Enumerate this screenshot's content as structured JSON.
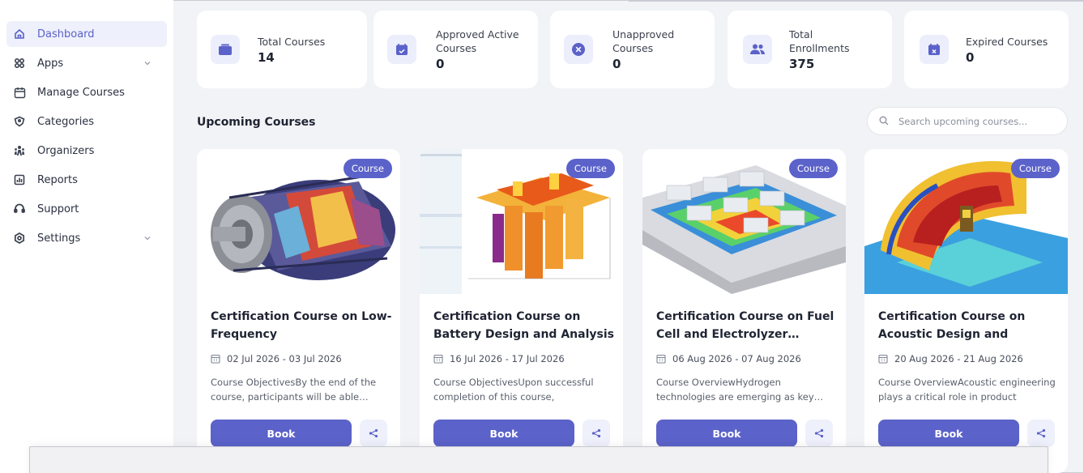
{
  "sidebar": {
    "items": [
      {
        "label": "Dashboard",
        "icon": "home-icon",
        "active": true
      },
      {
        "label": "Apps",
        "icon": "apps-icon",
        "expandable": true
      },
      {
        "label": "Manage Courses",
        "icon": "calendar-icon"
      },
      {
        "label": "Categories",
        "icon": "tag-icon"
      },
      {
        "label": "Organizers",
        "icon": "organizers-icon"
      },
      {
        "label": "Reports",
        "icon": "report-icon"
      },
      {
        "label": "Support",
        "icon": "support-icon"
      },
      {
        "label": "Settings",
        "icon": "settings-icon",
        "expandable": true
      }
    ]
  },
  "stats": [
    {
      "label": "Total Courses",
      "value": "14",
      "icon": "folder-icon"
    },
    {
      "label": "Approved Active Courses",
      "value": "0",
      "icon": "calendar-check-icon"
    },
    {
      "label": "Unapproved Courses",
      "value": "0",
      "icon": "x-circle-icon"
    },
    {
      "label": "Total Enrollments",
      "value": "375",
      "icon": "users-icon"
    },
    {
      "label": "Expired Courses",
      "value": "0",
      "icon": "calendar-x-icon"
    }
  ],
  "upcoming": {
    "title": "Upcoming Courses",
    "search_placeholder": "Search upcoming courses..."
  },
  "courses": [
    {
      "badge": "Course",
      "title": "Certification Course on Low-Frequency Electromagnetic…",
      "date": "02 Jul 2026 - 03 Jul 2026",
      "description": "Course ObjectivesBy the end of the course, participants will be able…",
      "book_label": "Book"
    },
    {
      "badge": "Course",
      "title": "Certification Course on Battery Design and Analysis",
      "date": "16 Jul 2026 - 17 Jul 2026",
      "description": "Course ObjectivesUpon successful completion of this course, participan…",
      "book_label": "Book"
    },
    {
      "badge": "Course",
      "title": "Certification Course on Fuel Cell and Electrolyzer…",
      "date": "06 Aug 2026 - 07 Aug 2026",
      "description": "Course OverviewHydrogen technologies are emerging as key…",
      "book_label": "Book"
    },
    {
      "badge": "Course",
      "title": "Certification Course on Acoustic Design and Analysis",
      "date": "20 Aug 2026 - 21 Aug 2026",
      "description": "Course OverviewAcoustic engineering plays a critical role in product design,…",
      "book_label": "Book"
    }
  ],
  "colors": {
    "accent": "#5b62c9",
    "accent_light": "#eef0fb",
    "background": "#f2f3f6"
  }
}
